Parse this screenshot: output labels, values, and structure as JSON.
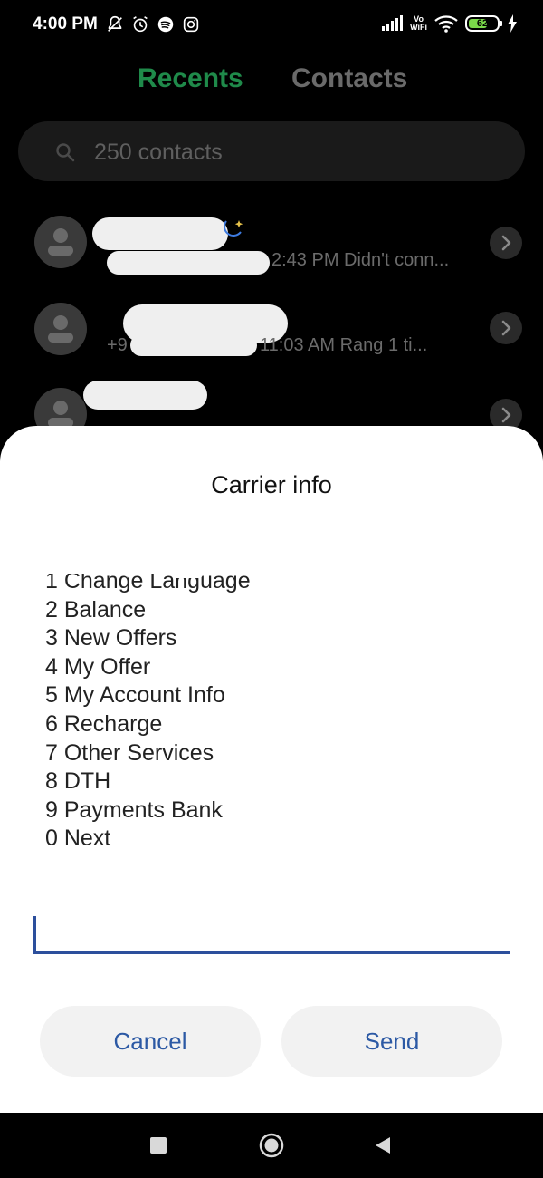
{
  "status_bar": {
    "time": "4:00 PM",
    "icons_left": [
      "mute-bell-icon",
      "alarm-icon",
      "spotify-icon",
      "instagram-icon"
    ],
    "icons_right": [
      "signal-icon",
      "vowifi-icon",
      "wifi-icon",
      "battery-icon",
      "charging-icon"
    ],
    "vowifi_top": "Vo",
    "vowifi_bottom": "WiFi",
    "battery_level": "62"
  },
  "tabs": {
    "recents": "Recents",
    "contacts": "Contacts",
    "active": "recents",
    "active_color": "#1f8a4a"
  },
  "search": {
    "placeholder": "250 contacts"
  },
  "recents": [
    {
      "detail": "2:43 PM Didn't conn..."
    },
    {
      "detail": "+9",
      "detail_suffix": "11:03 AM Rang 1 ti..."
    },
    {
      "detail": ""
    }
  ],
  "dialog": {
    "title": "Carrier info",
    "lines": [
      "1 Change Language",
      "2 Balance",
      "3 New Offers",
      "4 My Offer",
      "5 My Account Info",
      "6 Recharge",
      "7 Other Services",
      "8 DTH",
      "9 Payments Bank",
      "0 Next"
    ],
    "input_value": "",
    "cancel_label": "Cancel",
    "send_label": "Send",
    "accent_color": "#2c59a4"
  },
  "nav_bar": {
    "icons": [
      "recent-apps-icon",
      "home-icon",
      "back-icon"
    ]
  }
}
